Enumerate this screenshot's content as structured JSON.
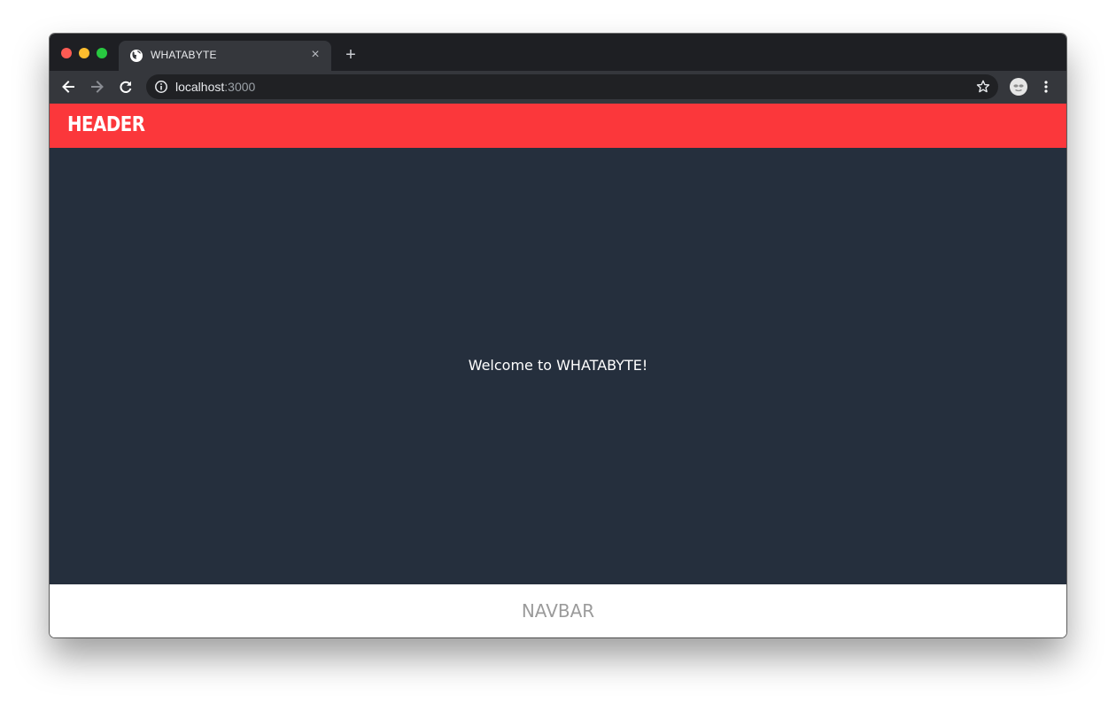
{
  "browser": {
    "tab": {
      "title": "WHATABYTE",
      "favicon": "globe-icon",
      "close_glyph": "×"
    },
    "new_tab_glyph": "+",
    "address_bar": {
      "host": "localhost",
      "port": ":3000"
    },
    "icons": {
      "back": "arrow-left-icon",
      "forward": "arrow-right-icon",
      "reload": "reload-icon",
      "info": "info-icon",
      "bookmark": "star-icon",
      "profile": "profile-icon",
      "menu": "kebab-menu-icon"
    }
  },
  "app": {
    "header_title": "HEADER",
    "welcome_text": "Welcome to WHATABYTE!",
    "navbar_label": "NAVBAR"
  },
  "colors": {
    "header": "#fb373b",
    "content": "#252f3d",
    "navbar": "#ffffff",
    "navbar_text": "#9b9b9b"
  }
}
